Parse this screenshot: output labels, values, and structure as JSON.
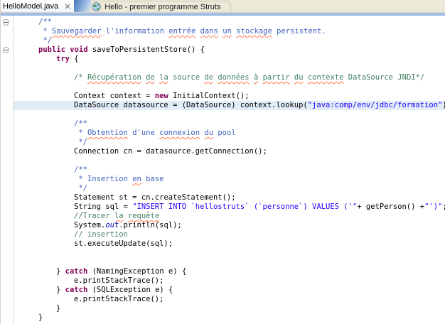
{
  "tabbar": {
    "tabs": [
      {
        "label": "HelloModel.java",
        "state": "active",
        "has_close_button": true
      },
      {
        "label": "Hello - premier programme Struts",
        "state": "inactive",
        "icon": "globe-icon"
      }
    ]
  },
  "colors": {
    "keyword": "#7f0055",
    "comment": "#3f7f5f",
    "javadoc": "#3f5fbf",
    "string": "#2a00ff",
    "static_field": "#0000c0",
    "current_line_highlight": "#e2edf8",
    "tab_strip_background": "#ece9d8",
    "active_band": "#8fb2de",
    "spellcheck_squiggle": "#ff7a50"
  },
  "editor": {
    "language": "java",
    "current_line_index": 9,
    "lines": [
      {
        "indent": 1,
        "fold": true,
        "seg": [
          [
            "/**",
            "j"
          ]
        ]
      },
      {
        "indent": 1,
        "seg": [
          [
            " * ",
            "j"
          ],
          [
            "Sauvegarder",
            "j sp"
          ],
          [
            " l'information ",
            "j"
          ],
          [
            "entrée",
            "j sp"
          ],
          [
            " ",
            "j"
          ],
          [
            "dans",
            "j sp"
          ],
          [
            " ",
            "j"
          ],
          [
            "un",
            "j sp"
          ],
          [
            " ",
            "j"
          ],
          [
            "stockage",
            "j sp"
          ],
          [
            " persistent.",
            "j"
          ]
        ]
      },
      {
        "indent": 1,
        "seg": [
          [
            " */",
            "j"
          ]
        ]
      },
      {
        "indent": 1,
        "fold": true,
        "seg": [
          [
            "public void",
            "k"
          ],
          [
            " saveToPersistentStore() {",
            "d"
          ]
        ]
      },
      {
        "indent": 2,
        "seg": [
          [
            "try",
            "k"
          ],
          [
            " {",
            "d"
          ]
        ]
      },
      {
        "indent": 0,
        "seg": []
      },
      {
        "indent": 3,
        "seg": [
          [
            "/* ",
            "c"
          ],
          [
            "Récupération",
            "c sp"
          ],
          [
            " ",
            "c"
          ],
          [
            "de",
            "c sp"
          ],
          [
            " ",
            "c"
          ],
          [
            "la",
            "c sp"
          ],
          [
            " source ",
            "c"
          ],
          [
            "de",
            "c sp"
          ],
          [
            " ",
            "c"
          ],
          [
            "données",
            "c sp"
          ],
          [
            " ",
            "c"
          ],
          [
            "à",
            "c sp"
          ],
          [
            " ",
            "c"
          ],
          [
            "partir",
            "c sp"
          ],
          [
            " ",
            "c"
          ],
          [
            "du",
            "c sp"
          ],
          [
            " ",
            "c"
          ],
          [
            "contexte",
            "c sp"
          ],
          [
            " DataSource JNDI*/",
            "c"
          ]
        ]
      },
      {
        "indent": 0,
        "seg": []
      },
      {
        "indent": 3,
        "seg": [
          [
            "Context context = ",
            "d"
          ],
          [
            "new",
            "k"
          ],
          [
            " InitialContext();",
            "d"
          ]
        ]
      },
      {
        "indent": 3,
        "hl": true,
        "seg": [
          [
            "DataSource datasource = (DataSource) context.lookup(",
            "d"
          ],
          [
            "\"java:comp/env/jdbc/formation\"",
            "s"
          ],
          [
            ");",
            "d"
          ]
        ]
      },
      {
        "indent": 0,
        "seg": []
      },
      {
        "indent": 3,
        "seg": [
          [
            "/**",
            "j"
          ]
        ]
      },
      {
        "indent": 3,
        "seg": [
          [
            " * ",
            "j"
          ],
          [
            "Obtention",
            "j sp"
          ],
          [
            " d'une ",
            "j"
          ],
          [
            "connexion",
            "j sp"
          ],
          [
            " ",
            "j"
          ],
          [
            "du",
            "j sp"
          ],
          [
            " pool",
            "j"
          ]
        ]
      },
      {
        "indent": 3,
        "seg": [
          [
            " */",
            "j"
          ]
        ]
      },
      {
        "indent": 3,
        "seg": [
          [
            "Connection cn = datasource.getConnection();",
            "d"
          ]
        ]
      },
      {
        "indent": 0,
        "seg": []
      },
      {
        "indent": 3,
        "seg": [
          [
            "/**",
            "j"
          ]
        ]
      },
      {
        "indent": 3,
        "seg": [
          [
            " * Insertion ",
            "j"
          ],
          [
            "en",
            "j sp"
          ],
          [
            " base",
            "j"
          ]
        ]
      },
      {
        "indent": 3,
        "seg": [
          [
            " */",
            "j"
          ]
        ]
      },
      {
        "indent": 3,
        "seg": [
          [
            "Statement st = cn.createStatement();",
            "d"
          ]
        ]
      },
      {
        "indent": 3,
        "seg": [
          [
            "String sql = ",
            "d"
          ],
          [
            "\"INSERT INTO `hellostruts` (`personne`) VALUES ('\"",
            "s"
          ],
          [
            "+ getPerson() +",
            "d"
          ],
          [
            "\"')\"",
            "s"
          ],
          [
            ";",
            "d"
          ]
        ]
      },
      {
        "indent": 3,
        "seg": [
          [
            "//Tracer ",
            "c"
          ],
          [
            "la",
            "c sp"
          ],
          [
            " ",
            "c"
          ],
          [
            "requête",
            "c sp"
          ]
        ]
      },
      {
        "indent": 3,
        "seg": [
          [
            "System.",
            "d"
          ],
          [
            "out",
            "f"
          ],
          [
            ".println(sql);",
            "d"
          ]
        ]
      },
      {
        "indent": 3,
        "seg": [
          [
            "// insertion",
            "c"
          ]
        ]
      },
      {
        "indent": 3,
        "seg": [
          [
            "st.executeUpdate(sql);",
            "d"
          ]
        ]
      },
      {
        "indent": 0,
        "seg": []
      },
      {
        "indent": 0,
        "seg": []
      },
      {
        "indent": 2,
        "seg": [
          [
            "} ",
            "d"
          ],
          [
            "catch",
            "k"
          ],
          [
            " (NamingException e) {",
            "d"
          ]
        ]
      },
      {
        "indent": 3,
        "seg": [
          [
            "e.printStackTrace();",
            "d"
          ]
        ]
      },
      {
        "indent": 2,
        "seg": [
          [
            "} ",
            "d"
          ],
          [
            "catch",
            "k"
          ],
          [
            " (SQLException e) {",
            "d"
          ]
        ]
      },
      {
        "indent": 3,
        "seg": [
          [
            "e.printStackTrace();",
            "d"
          ]
        ]
      },
      {
        "indent": 2,
        "seg": [
          [
            "}",
            "d"
          ]
        ]
      },
      {
        "indent": 1,
        "seg": [
          [
            "}",
            "d"
          ]
        ]
      }
    ]
  }
}
